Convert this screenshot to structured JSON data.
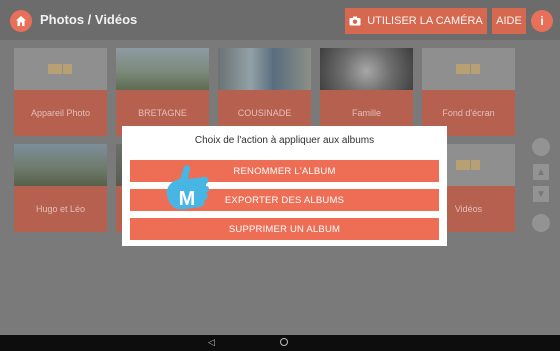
{
  "header": {
    "title": "Photos / Vidéos",
    "camera_label": "UTILISER LA CAMÉRA",
    "help_label": "AIDE",
    "info_symbol": "i"
  },
  "albums": [
    {
      "label": "Appareil Photo",
      "thumb": "video-camera-icon"
    },
    {
      "label": "BRETAGNE",
      "thumb": "photo"
    },
    {
      "label": "COUSINADE",
      "thumb": "photo"
    },
    {
      "label": "Famille",
      "thumb": "photo"
    },
    {
      "label": "Fond d'écran",
      "thumb": "video-camera-icon"
    },
    {
      "label": "Hugo et Léo",
      "thumb": "photo"
    },
    {
      "label": "Vidéos",
      "thumb": "video-camera-icon"
    }
  ],
  "dialog": {
    "title": "Choix de l'action à appliquer aux albums",
    "actions": [
      "RENOMMER L'ALBUM",
      "EXPORTER DES ALBUMS",
      "SUPPRIMER UN ALBUM"
    ]
  },
  "colors": {
    "accent": "#ee6e55",
    "overlay_logo": "#47b6e4",
    "topbar": "#6c6c6c"
  },
  "watermark_letter": "M"
}
